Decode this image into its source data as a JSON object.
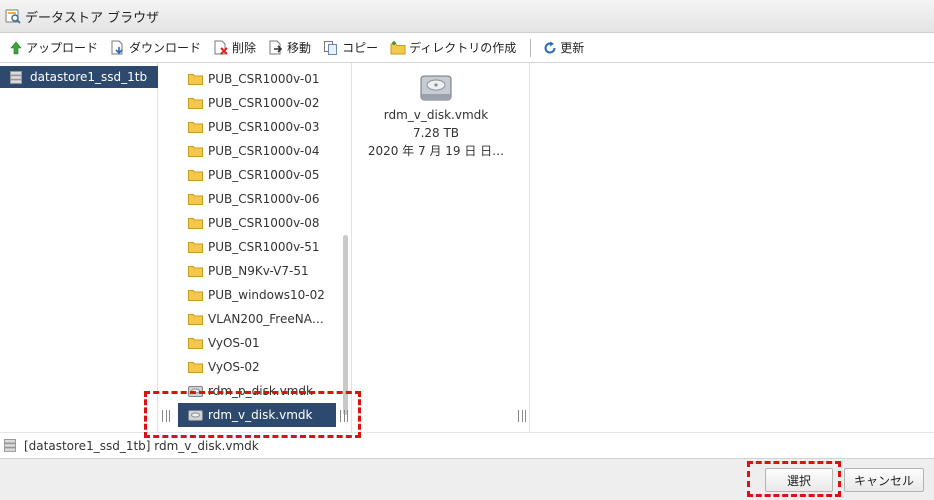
{
  "window": {
    "title": "データストア ブラウザ",
    "title_icon": "datastore-browser-icon"
  },
  "toolbar": {
    "upload_label": "アップロード",
    "download_label": "ダウンロード",
    "delete_label": "削除",
    "move_label": "移動",
    "copy_label": "コピー",
    "mkdir_label": "ディレクトリの作成",
    "refresh_label": "更新"
  },
  "datastores": [
    {
      "label": "datastore1_ssd_1tb",
      "selected": true
    }
  ],
  "files": [
    {
      "label": "PUB_CSR1000v-01",
      "type": "folder"
    },
    {
      "label": "PUB_CSR1000v-02",
      "type": "folder"
    },
    {
      "label": "PUB_CSR1000v-03",
      "type": "folder"
    },
    {
      "label": "PUB_CSR1000v-04",
      "type": "folder"
    },
    {
      "label": "PUB_CSR1000v-05",
      "type": "folder"
    },
    {
      "label": "PUB_CSR1000v-06",
      "type": "folder"
    },
    {
      "label": "PUB_CSR1000v-08",
      "type": "folder"
    },
    {
      "label": "PUB_CSR1000v-51",
      "type": "folder"
    },
    {
      "label": "PUB_N9Kv-V7-51",
      "type": "folder"
    },
    {
      "label": "PUB_windows10-02",
      "type": "folder"
    },
    {
      "label": "VLAN200_FreeNA…",
      "type": "folder"
    },
    {
      "label": "VyOS-01",
      "type": "folder"
    },
    {
      "label": "VyOS-02",
      "type": "folder"
    },
    {
      "label": "rdm_p_disk.vmdk",
      "type": "disk"
    },
    {
      "label": "rdm_v_disk.vmdk",
      "type": "disk",
      "selected": true
    }
  ],
  "details": {
    "name": "rdm_v_disk.vmdk",
    "size": "7.28 TB",
    "date": "2020 年 7 月 19 日 日…"
  },
  "path": "[datastore1_ssd_1tb] rdm_v_disk.vmdk",
  "footer": {
    "select_label": "選択",
    "cancel_label": "キャンセル"
  },
  "colors": {
    "selection": "#2d4a6e",
    "highlight": "#e01010",
    "folder": "#f2c94c"
  }
}
